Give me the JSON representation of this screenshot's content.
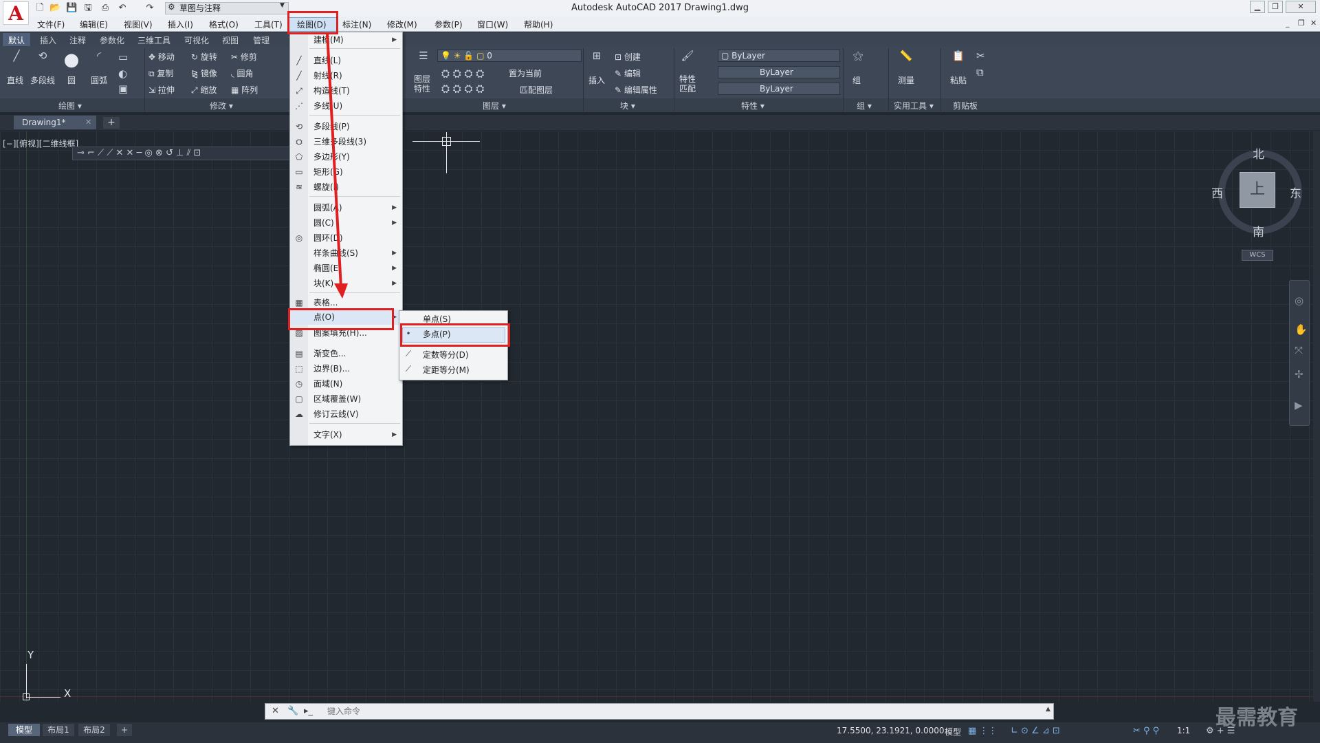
{
  "window": {
    "title": "Autodesk AutoCAD 2017    Drawing1.dwg",
    "logo": "A"
  },
  "workspace": "草图与注释",
  "menubar": [
    "文件(F)",
    "编辑(E)",
    "视图(V)",
    "插入(I)",
    "格式(O)",
    "工具(T)",
    "绘图(D)",
    "标注(N)",
    "修改(M)",
    "参数(P)",
    "窗口(W)",
    "帮助(H)"
  ],
  "ribbon": {
    "tabs": [
      "默认",
      "插入",
      "注释",
      "参数化",
      "三维工具",
      "可视化",
      "视图",
      "管理"
    ],
    "draw_tools": [
      "直线",
      "多段线",
      "圆",
      "圆弧"
    ],
    "modify_tools": [
      "移动",
      "旋转",
      "修剪",
      "复制",
      "镜像",
      "圆角",
      "拉伸",
      "缩放",
      "阵列"
    ],
    "layer_tools": {
      "big": "图层\n特性",
      "layer_value": "0",
      "set_current": "置为当前",
      "match_layer": "匹配图层"
    },
    "block_tools": {
      "insert": "插入",
      "create": "创建",
      "edit": "编辑",
      "edit_attr": "编辑属性"
    },
    "props_tools": {
      "match": "特性\n匹配",
      "color": "ByLayer",
      "linetype": "ByLayer",
      "lineweight": "ByLayer"
    },
    "group_tools": {
      "group": "组"
    },
    "util_tools": {
      "measure": "测量"
    },
    "clip_tools": {
      "paste": "粘贴"
    },
    "panels": [
      "绘图 ▾",
      "修改 ▾",
      "图层 ▾",
      "块 ▾",
      "特性 ▾",
      "组 ▾",
      "实用工具 ▾",
      "剪贴板"
    ]
  },
  "doc_tab": "Drawing1*",
  "viewport_label": "[−][俯视][二维线框]",
  "ucs": {
    "x": "X",
    "y": "Y"
  },
  "viewcube": {
    "north": "北",
    "south": "南",
    "east": "东",
    "west": "西",
    "face": "上",
    "wcs": "WCS"
  },
  "draw_menu": {
    "items": [
      {
        "label": "建模(M)",
        "submenu": true
      },
      {
        "label": "直线(L)"
      },
      {
        "label": "射线(R)"
      },
      {
        "label": "构造线(T)"
      },
      {
        "label": "多线(U)"
      },
      {
        "label": "多段线(P)"
      },
      {
        "label": "三维多段线(3)"
      },
      {
        "label": "多边形(Y)"
      },
      {
        "label": "矩形(G)"
      },
      {
        "label": "螺旋(I)"
      },
      {
        "label": "圆弧(A)",
        "submenu": true
      },
      {
        "label": "圆(C)",
        "submenu": true
      },
      {
        "label": "圆环(D)"
      },
      {
        "label": "样条曲线(S)",
        "submenu": true
      },
      {
        "label": "椭圆(E)",
        "submenu": true
      },
      {
        "label": "块(K)",
        "submenu": true
      },
      {
        "label": "表格..."
      },
      {
        "label": "点(O)",
        "submenu": true
      },
      {
        "label": "图案填充(H)..."
      },
      {
        "label": "渐变色..."
      },
      {
        "label": "边界(B)..."
      },
      {
        "label": "面域(N)"
      },
      {
        "label": "区域覆盖(W)"
      },
      {
        "label": "修订云线(V)"
      },
      {
        "label": "文字(X)",
        "submenu": true
      }
    ]
  },
  "point_submenu": [
    "单点(S)",
    "多点(P)",
    "定数等分(D)",
    "定距等分(M)"
  ],
  "command_line": {
    "placeholder": "键入命令"
  },
  "layout_tabs": [
    "模型",
    "布局1",
    "布局2"
  ],
  "status": {
    "coords": "17.5500, 23.1921, 0.0000",
    "model": "模型",
    "scale": "1:1"
  },
  "watermark": "最需教育",
  "colors": {
    "accent_red": "#e02020",
    "canvas_bg": "#212830"
  }
}
